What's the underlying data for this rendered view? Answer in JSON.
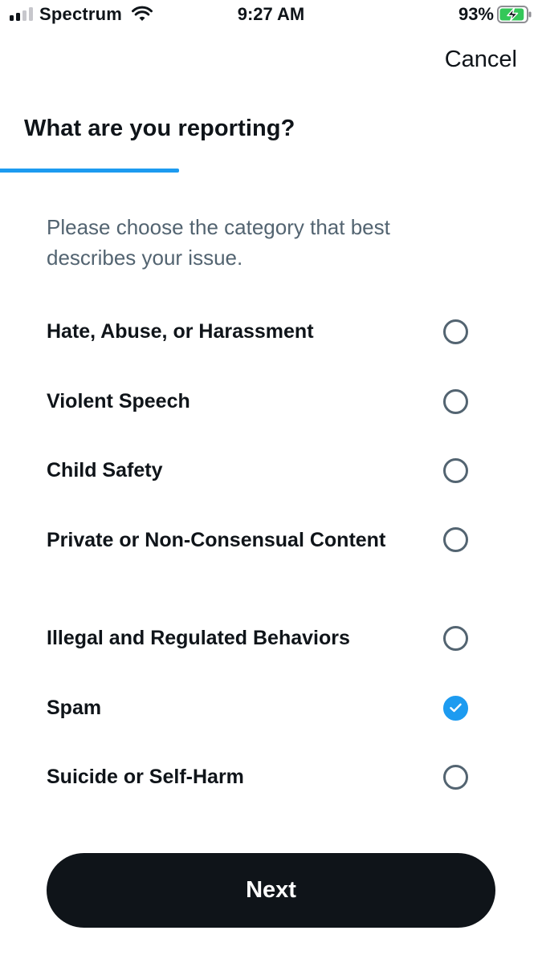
{
  "status_bar": {
    "carrier": "Spectrum",
    "time": "9:27 AM",
    "battery_percent": "93%",
    "battery_level": 0.93,
    "signal_bars_active": 2,
    "signal_bars_total": 4,
    "icons": [
      "signal-icon",
      "wifi-icon",
      "battery-charging-icon"
    ]
  },
  "header": {
    "cancel_label": "Cancel",
    "title": "What are you reporting?",
    "progress": 0.33,
    "accent_color": "#1d9bf0"
  },
  "description": "Please choose the category that best describes your issue.",
  "options": [
    {
      "label": "Hate, Abuse, or Harassment",
      "selected": false
    },
    {
      "label": "Violent Speech",
      "selected": false
    },
    {
      "label": "Child Safety",
      "selected": false
    },
    {
      "label": "Private or Non-Consensual Content",
      "selected": false
    },
    {
      "label": "Illegal and Regulated Behaviors",
      "selected": false
    },
    {
      "label": "Spam",
      "selected": true
    },
    {
      "label": "Suicide or Self-Harm",
      "selected": false
    }
  ],
  "next_button_label": "Next",
  "colors": {
    "text_primary": "#0f1419",
    "text_secondary": "#536471",
    "accent": "#1d9bf0",
    "battery_green": "#34c759"
  }
}
